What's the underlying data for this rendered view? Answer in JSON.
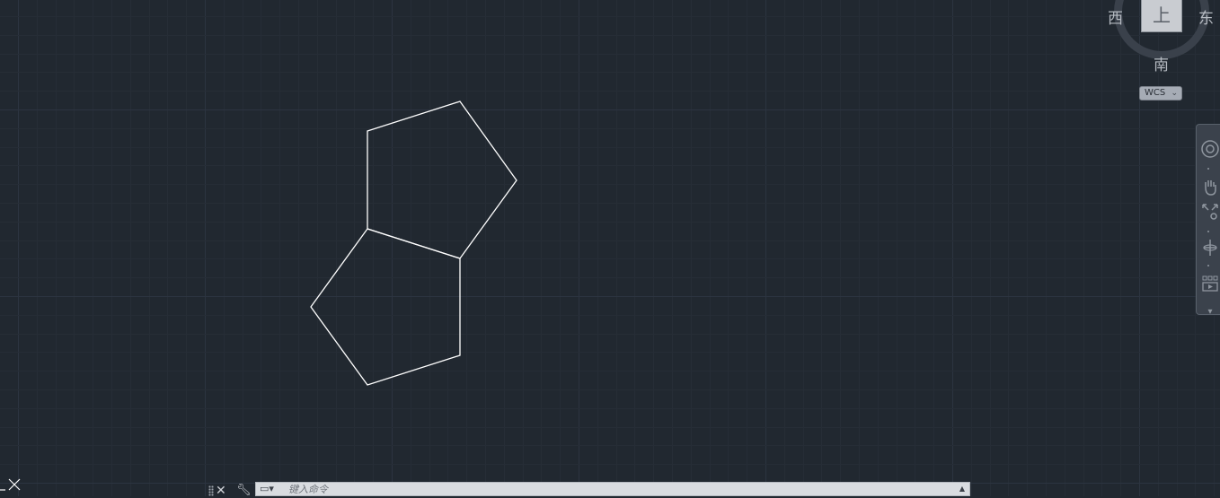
{
  "viewcube": {
    "face_label": "上",
    "west": "西",
    "east": "东",
    "south": "南",
    "wcs_label": "WCS"
  },
  "navbar": {
    "items": [
      {
        "name": "steering-wheel-icon"
      },
      {
        "name": "pan-icon"
      },
      {
        "name": "zoom-extents-icon"
      },
      {
        "name": "orbit-icon"
      },
      {
        "name": "showmotion-icon"
      }
    ]
  },
  "command_line": {
    "placeholder": "键入命令"
  },
  "colors": {
    "background": "#212830",
    "grid_minor": "#262d36",
    "grid_major": "#2c3440",
    "geometry": "#ffffff"
  }
}
